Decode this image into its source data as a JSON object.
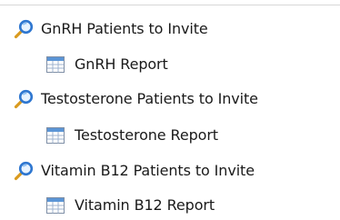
{
  "tree": {
    "items": [
      {
        "label": "GnRH Patients to Invite",
        "icon": "magnifier-icon",
        "level": 0
      },
      {
        "label": "GnRH Report",
        "icon": "table-report-icon",
        "level": 1
      },
      {
        "label": "Testosterone Patients to Invite",
        "icon": "magnifier-icon",
        "level": 0
      },
      {
        "label": "Testosterone Report",
        "icon": "table-report-icon",
        "level": 1
      },
      {
        "label": "Vitamin B12 Patients to Invite",
        "icon": "magnifier-icon",
        "level": 0
      },
      {
        "label": "Vitamin B12 Report",
        "icon": "table-report-icon",
        "level": 1
      }
    ]
  },
  "colors": {
    "magnifier_lens": "#2f77d0",
    "magnifier_handle": "#d99a1e",
    "table_header": "#5b95d6",
    "table_border": "#7f8fa6",
    "table_cell": "#ffffff"
  }
}
